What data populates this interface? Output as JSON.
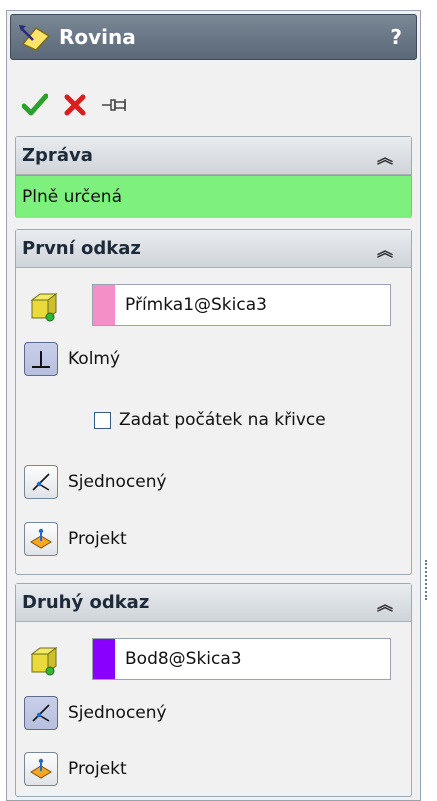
{
  "title": "Rovina",
  "help_label": "?",
  "actions": {
    "ok_icon": "checkmark-icon",
    "cancel_icon": "x-icon",
    "pin_icon": "pushpin-icon"
  },
  "message_group": {
    "header": "Zpráva",
    "status": "Plně určená",
    "status_color": "#7df07d"
  },
  "first_reference": {
    "header": "První odkaz",
    "selection": "Přímka1@Skica3",
    "swatch_color": "#f58fc8",
    "perpendicular_label": "Kolmý",
    "set_origin_label": "Zadat počátek na křivce",
    "coincident_label": "Sjednocený",
    "project_label": "Projekt"
  },
  "second_reference": {
    "header": "Druhý odkaz",
    "selection": "Bod8@Skica3",
    "swatch_color": "#8a00ff",
    "coincident_label": "Sjednocený",
    "project_label": "Projekt"
  },
  "collapse_glyph": "≈"
}
